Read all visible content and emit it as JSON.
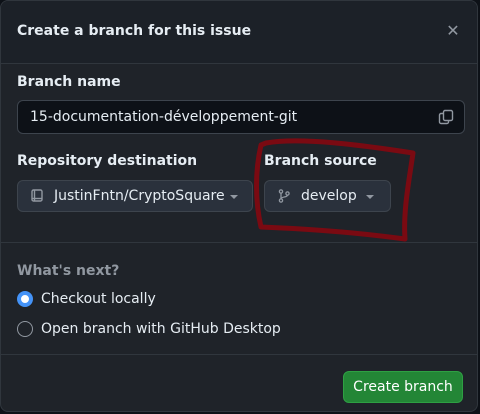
{
  "dialog": {
    "title": "Create a branch for this issue",
    "close_icon": "close-icon"
  },
  "branch_name": {
    "label": "Branch name",
    "value": "15-documentation-développement-git",
    "copy_icon": "copy-icon"
  },
  "repository_destination": {
    "label": "Repository destination",
    "value": "JustinFntn/CryptoSquare",
    "icon": "repo-icon"
  },
  "branch_source": {
    "label": "Branch source",
    "value": "develop",
    "icon": "git-branch-icon"
  },
  "whats_next": {
    "label": "What's next?",
    "options": [
      {
        "label": "Checkout locally",
        "selected": true
      },
      {
        "label": "Open branch with GitHub Desktop",
        "selected": false
      }
    ]
  },
  "footer": {
    "create_label": "Create branch"
  },
  "colors": {
    "background": "#1f2329",
    "accent_blue": "#4493f8",
    "primary_green": "#238636",
    "annotation_red": "#7a0a12"
  }
}
